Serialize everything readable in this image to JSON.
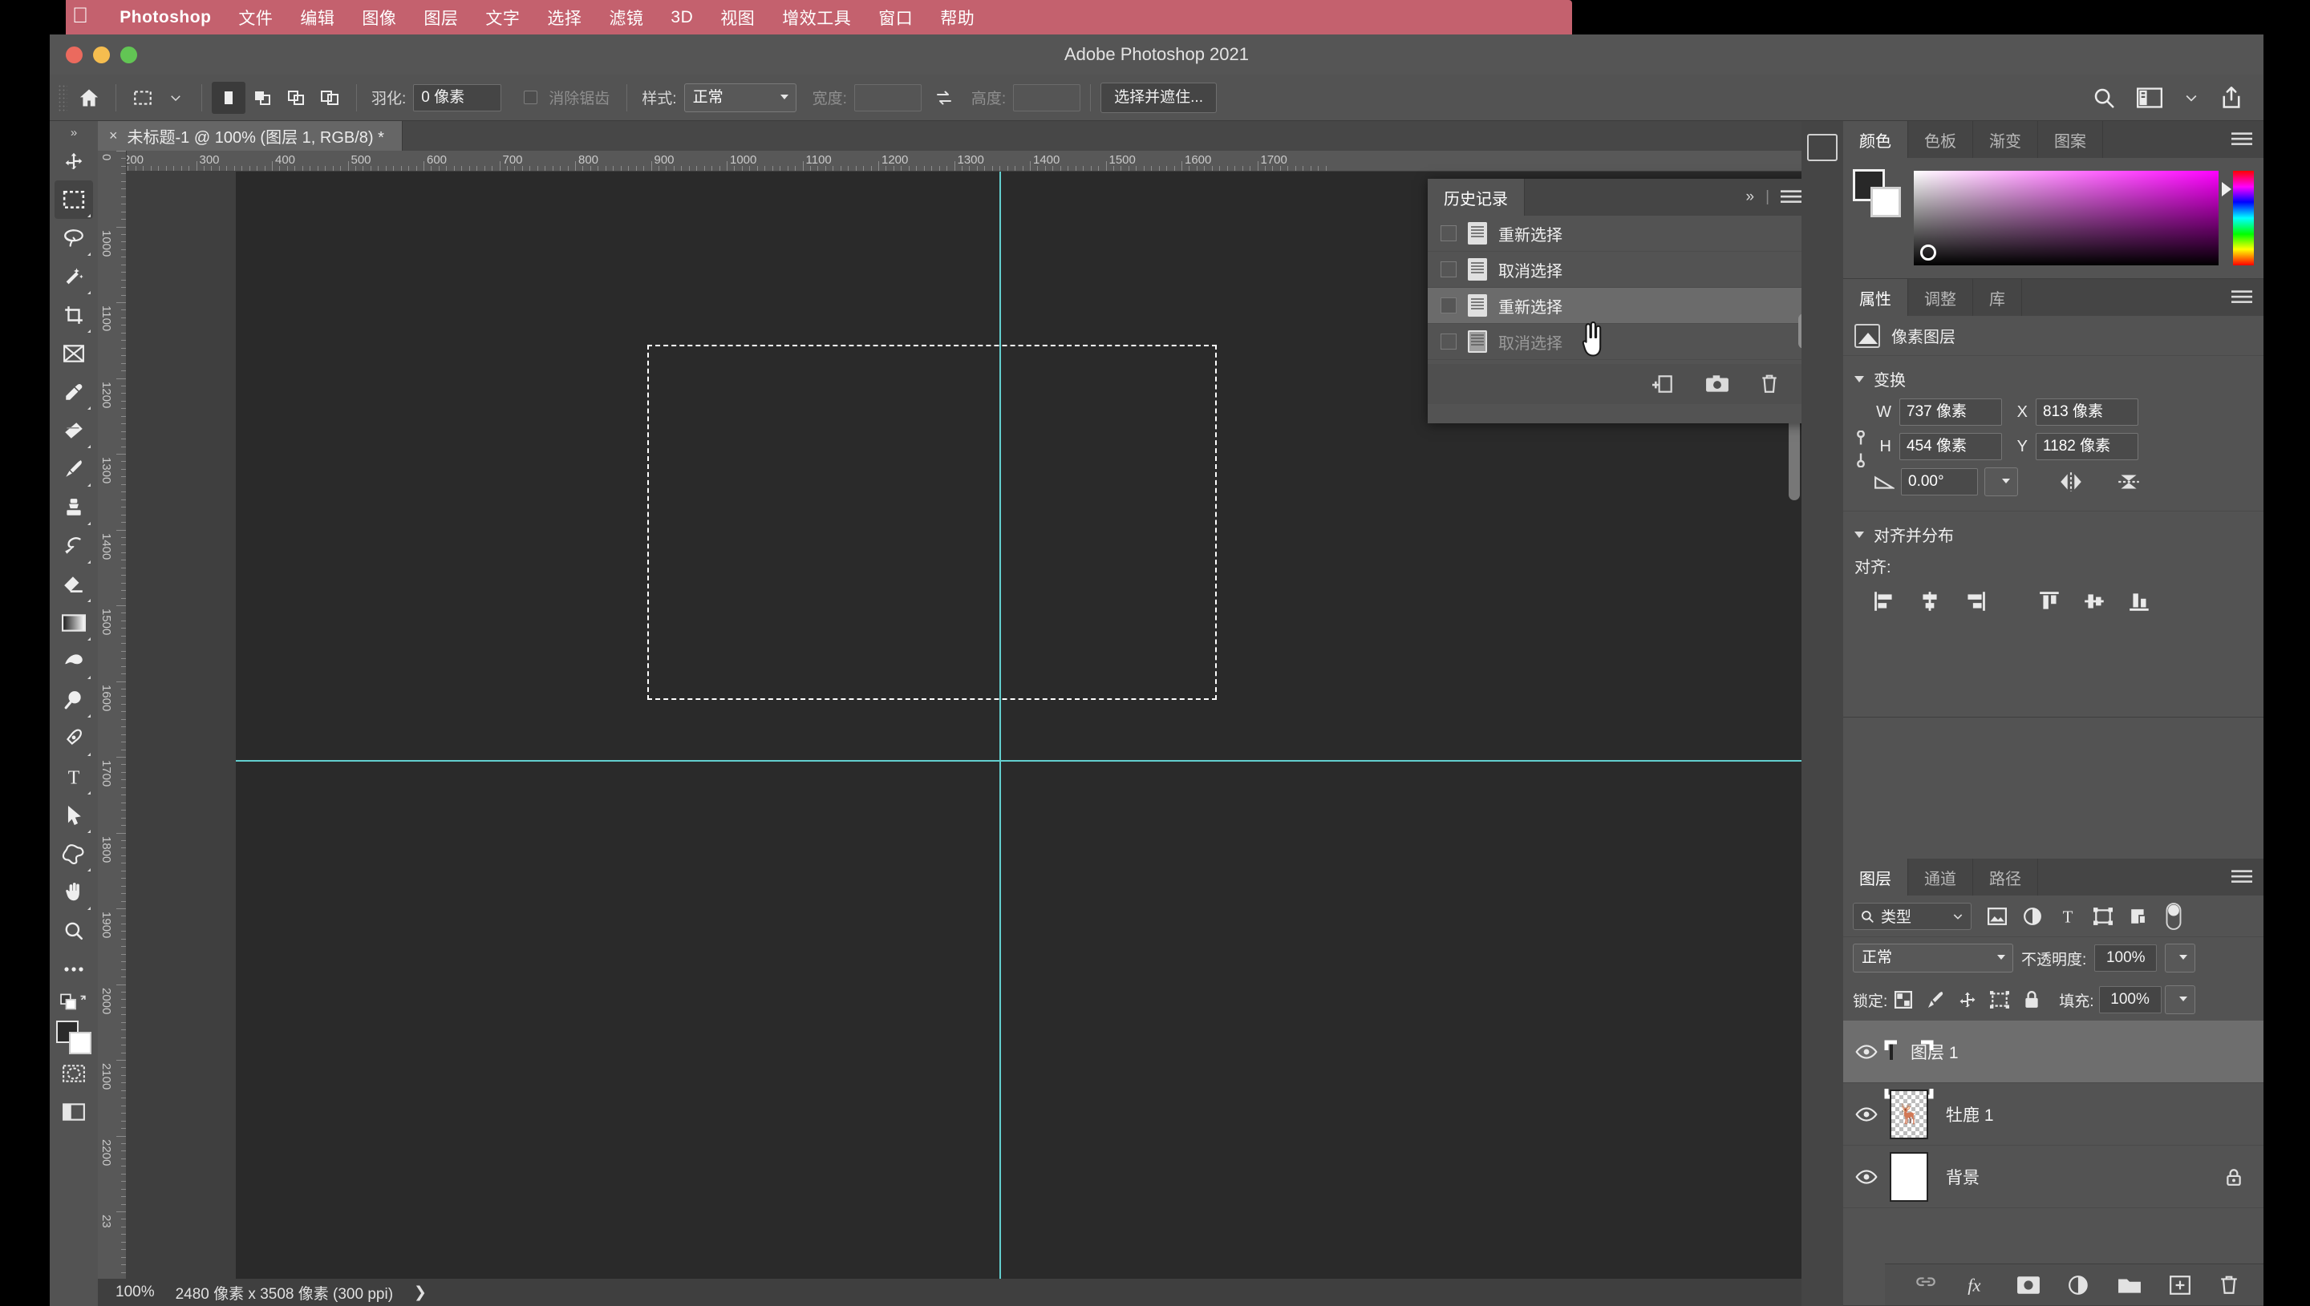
{
  "macmenu": {
    "apple_icon": "apple-icon",
    "items": [
      {
        "label": "Photoshop",
        "bold": true
      },
      {
        "label": "文件"
      },
      {
        "label": "编辑"
      },
      {
        "label": "图像"
      },
      {
        "label": "图层"
      },
      {
        "label": "文字"
      },
      {
        "label": "选择"
      },
      {
        "label": "滤镜"
      },
      {
        "label": "3D"
      },
      {
        "label": "视图"
      },
      {
        "label": "增效工具"
      },
      {
        "label": "窗口"
      },
      {
        "label": "帮助"
      }
    ]
  },
  "window": {
    "title": "Adobe Photoshop 2021"
  },
  "options_bar": {
    "home_icon": "home-icon",
    "tool_icon": "rect-marquee-icon",
    "tool_chevron": "chevron-down-icon",
    "modes": [
      "new-selection",
      "add-to-selection",
      "subtract-from-selection",
      "intersect-selection"
    ],
    "feather_label": "羽化:",
    "feather_value": "0 像素",
    "antialias_label": "消除锯齿",
    "style_label": "样式:",
    "style_value": "正常",
    "width_label": "宽度:",
    "width_value": "",
    "swap_icon": "swap-arrows-icon",
    "height_label": "高度:",
    "height_value": "",
    "select_and_mask": "选择并遮住...",
    "right_icons": [
      "search-icon",
      "workspace-icon",
      "chevron-down-icon",
      "share-icon"
    ]
  },
  "toolbar": {
    "expand_icon": "expand-chevrons-icon",
    "tools": [
      {
        "name": "move-tool"
      },
      {
        "name": "rectangular-marquee-tool",
        "selected": true
      },
      {
        "name": "lasso-tool"
      },
      {
        "name": "quick-selection-tool"
      },
      {
        "name": "crop-tool"
      },
      {
        "name": "frame-tool"
      },
      {
        "name": "eyedropper-tool"
      },
      {
        "name": "spot-healing-brush-tool"
      },
      {
        "name": "brush-tool"
      },
      {
        "name": "clone-stamp-tool"
      },
      {
        "name": "history-brush-tool"
      },
      {
        "name": "eraser-tool"
      },
      {
        "name": "gradient-tool"
      },
      {
        "name": "dodge-tool"
      },
      {
        "name": "blur-tool"
      },
      {
        "name": "pen-tool"
      },
      {
        "name": "type-tool"
      },
      {
        "name": "path-selection-tool"
      },
      {
        "name": "custom-shape-tool"
      },
      {
        "name": "hand-tool"
      },
      {
        "name": "zoom-tool"
      },
      {
        "name": "edit-toolbar-tool"
      }
    ],
    "quickmask_icon": "quick-mask-icon",
    "screenmode_icon": "screen-mode-icon"
  },
  "document": {
    "tab_close_icon": "close-icon",
    "tab_title": "未标题-1 @ 100% (图层 1, RGB/8) *",
    "ruler_h_ticks": [
      "200",
      "300",
      "400",
      "500",
      "600",
      "700",
      "800",
      "900",
      "1000",
      "1100",
      "1200",
      "1300",
      "1400",
      "1500",
      "1600",
      "1700"
    ],
    "ruler_v_ticks": [
      "0",
      "1000",
      "1100",
      "1200",
      "1300",
      "1400",
      "1500",
      "1600",
      "1700",
      "1800",
      "1900",
      "2000",
      "2100",
      "2200",
      "23"
    ],
    "guide_color": "#63cfcf"
  },
  "status_bar": {
    "zoom": "100%",
    "dimensions": "2480 像素 x 3508 像素 (300 ppi)",
    "chevron": "❯"
  },
  "history_panel": {
    "tab_label": "历史记录",
    "collapse_icon": "double-chevron-right-icon",
    "menu_icon": "panel-menu-icon",
    "items": [
      {
        "label": "重新选择",
        "selected": false,
        "dim": false
      },
      {
        "label": "取消选择",
        "selected": false,
        "dim": false
      },
      {
        "label": "重新选择",
        "selected": true,
        "dim": false
      },
      {
        "label": "取消选择",
        "selected": false,
        "dim": true
      }
    ],
    "footer_icons": [
      "new-document-from-state-icon",
      "create-snapshot-icon",
      "delete-state-icon"
    ]
  },
  "color_panel": {
    "tabs": [
      {
        "label": "颜色",
        "active": true
      },
      {
        "label": "色板",
        "active": false
      },
      {
        "label": "渐变",
        "active": false
      },
      {
        "label": "图案",
        "active": false
      }
    ],
    "menu_icon": "panel-menu-icon",
    "foreground_color": "#282828",
    "background_color": "#ffffff",
    "picker_icon": "color-field",
    "hue_slider_icon": "hue-slider"
  },
  "properties_panel": {
    "tabs": [
      {
        "label": "属性",
        "active": true
      },
      {
        "label": "调整",
        "active": false
      },
      {
        "label": "库",
        "active": false
      }
    ],
    "menu_icon": "panel-menu-icon",
    "layer_type_icon": "pixel-layer-icon",
    "layer_type_label": "像素图层",
    "transform": {
      "section_label": "变换",
      "link_icon": "link-icon",
      "w_label": "W",
      "w_value": "737 像素",
      "x_label": "X",
      "x_value": "813 像素",
      "h_label": "H",
      "h_value": "454 像素",
      "y_label": "Y",
      "y_value": "1182 像素",
      "angle_icon": "angle-icon",
      "angle_value": "0.00°",
      "angle_chevron": "chevron-down-icon",
      "flip_h_icon": "flip-horizontal-icon",
      "flip_v_icon": "flip-vertical-icon"
    },
    "align": {
      "section_label": "对齐并分布",
      "align_label": "对齐:",
      "icons": [
        "align-left-icon",
        "align-center-h-icon",
        "align-right-icon",
        "align-top-icon",
        "align-center-v-icon",
        "align-bottom-icon"
      ]
    }
  },
  "layers_panel": {
    "tabs": [
      {
        "label": "图层",
        "active": true
      },
      {
        "label": "通道",
        "active": false
      },
      {
        "label": "路径",
        "active": false
      }
    ],
    "menu_icon": "panel-menu-icon",
    "filter": {
      "search_icon": "search-icon",
      "kind_label": "类型",
      "chevron": "chevron-down-icon",
      "icons": [
        "filter-image-icon",
        "filter-adjustment-icon",
        "filter-type-icon",
        "filter-shape-icon",
        "filter-smart-object-icon"
      ],
      "toggle_icon": "filter-toggle-switch"
    },
    "blend": {
      "mode": "正常",
      "opacity_label": "不透明度:",
      "opacity_value": "100%"
    },
    "lock": {
      "label": "锁定:",
      "icons": [
        "lock-transparent-pixels-icon",
        "lock-image-pixels-icon",
        "lock-position-icon",
        "lock-artboard-icon",
        "lock-all-icon"
      ],
      "fill_label": "填充:",
      "fill_value": "100%"
    },
    "layers": [
      {
        "name": "图层 1",
        "selected": true,
        "thumb": "black",
        "locked": false,
        "visible": true
      },
      {
        "name": "牡鹿 1",
        "selected": false,
        "thumb": "checker",
        "locked": false,
        "visible": true
      },
      {
        "name": "背景",
        "selected": false,
        "thumb": "white",
        "locked": true,
        "visible": true
      }
    ],
    "footer_icons": [
      "link-layers-icon",
      "layer-style-fx-icon",
      "add-layer-mask-icon",
      "new-fill-adjustment-layer-icon",
      "new-group-icon",
      "new-layer-icon",
      "delete-layer-icon"
    ]
  }
}
